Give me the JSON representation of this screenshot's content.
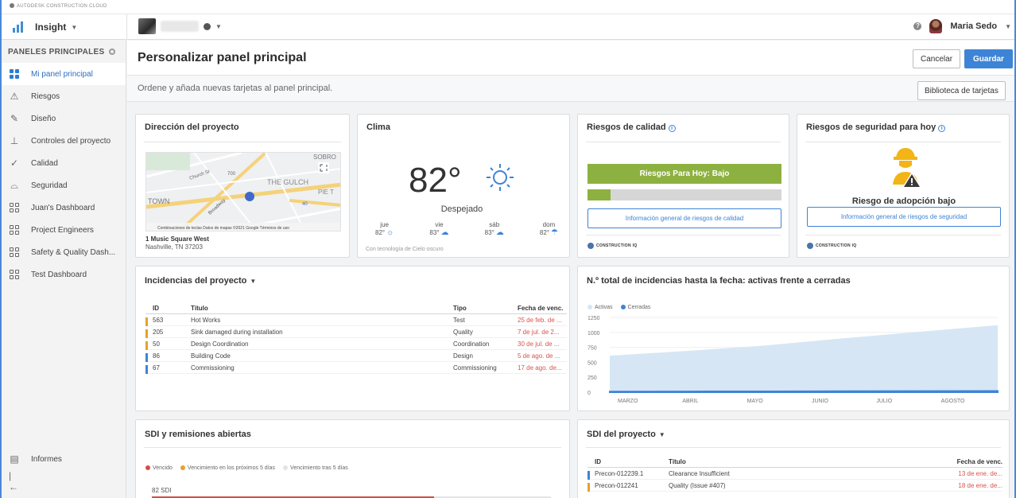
{
  "brand": "AUTODESK CONSTRUCTION CLOUD",
  "app": {
    "name": "Insight"
  },
  "user": {
    "name": "Maria Sedo"
  },
  "sidebar": {
    "section": "PANELES PRINCIPALES",
    "items": [
      {
        "label": "Mi panel principal",
        "icon": "dashboard-icon",
        "active": true
      },
      {
        "label": "Riesgos",
        "icon": "warning-icon"
      },
      {
        "label": "Diseño",
        "icon": "edit-icon"
      },
      {
        "label": "Controles del proyecto",
        "icon": "hierarchy-icon"
      },
      {
        "label": "Calidad",
        "icon": "check-icon"
      },
      {
        "label": "Seguridad",
        "icon": "helmet-icon"
      },
      {
        "label": "Juan's Dashboard",
        "icon": "dashboard-icon"
      },
      {
        "label": "Project Engineers",
        "icon": "dashboard-icon"
      },
      {
        "label": "Safety & Quality Dash...",
        "icon": "dashboard-icon"
      },
      {
        "label": "Test Dashboard",
        "icon": "dashboard-icon"
      }
    ],
    "reports": "Informes"
  },
  "page": {
    "title": "Personalizar panel principal",
    "cancel": "Cancelar",
    "save": "Guardar",
    "subtitle": "Ordene y añada nuevas tarjetas al panel principal.",
    "library": "Biblioteca de tarjetas"
  },
  "cards": {
    "location": {
      "title": "Dirección del proyecto",
      "map_labels": [
        "SOBRO",
        "THE GULCH",
        "PIE T",
        "TOWN",
        "Church St",
        "700",
        "Broadway",
        "40"
      ],
      "map_footer": "Combinaciones de teclas   Datos de mapas ©2021 Google   Términos de uso",
      "address1": "1 Music Square West",
      "address2": "Nashville, TN 37203"
    },
    "weather": {
      "title": "Clima",
      "temp": "82°",
      "condition": "Despejado",
      "forecast": [
        {
          "day": "jue",
          "temp": "82°",
          "icon": "sun-icon"
        },
        {
          "day": "vie",
          "temp": "83°",
          "icon": "partly-cloudy-icon"
        },
        {
          "day": "sáb",
          "temp": "83°",
          "icon": "partly-cloudy-icon"
        },
        {
          "day": "dom",
          "temp": "82°",
          "icon": "rain-icon"
        }
      ],
      "powered": "Con tecnología de Cielo oscuro"
    },
    "quality_risk": {
      "title": "Riesgos de calidad",
      "banner": "Riesgos Para Hoy: Bajo",
      "level": 0.12,
      "button": "Información general de riesgos de calidad",
      "brand": "CONSTRUCTION IQ"
    },
    "safety_risk": {
      "title": "Riesgos de seguridad para hoy",
      "status": "Riesgo de adopción bajo",
      "button": "Información general de riesgos de seguridad",
      "brand": "CONSTRUCTION IQ"
    },
    "issues": {
      "title": "Incidencias del proyecto",
      "columns": [
        "ID",
        "Título",
        "Tipo",
        "Fecha de venc."
      ],
      "rows": [
        {
          "id": "563",
          "title": "Hot Works",
          "type": "Test",
          "due": "25 de feb. de ...",
          "flag": "#e8a12a"
        },
        {
          "id": "205",
          "title": "Sink damaged during installation",
          "type": "Quality",
          "due": "7 de jul. de 2...",
          "flag": "#e8a12a"
        },
        {
          "id": "50",
          "title": "Design Coordination",
          "type": "Coordination",
          "due": "30 de jul. de ...",
          "flag": "#e8a12a"
        },
        {
          "id": "86",
          "title": "Building Code",
          "type": "Design",
          "due": "5 de ago. de ...",
          "flag": "#3d84d6"
        },
        {
          "id": "67",
          "title": "Commissioning",
          "type": "Commissioning",
          "due": "17 de ago. de...",
          "flag": "#3d84d6"
        }
      ]
    },
    "issues_chart": {
      "title": "N.º total de incidencias hasta la fecha: activas frente a cerradas"
    },
    "rfi": {
      "title": "SDI y remisiones abiertas",
      "legend": [
        {
          "label": "Vencido",
          "color": "#d84c42"
        },
        {
          "label": "Vencimiento en los próximos 5 días",
          "color": "#e8a12a"
        },
        {
          "label": "Vencimiento tras 5 días",
          "color": "#e4e4e4"
        }
      ],
      "total_label": "82 SDI",
      "overdue": 58,
      "later": 24
    },
    "project_rfi": {
      "title": "SDI del proyecto",
      "columns": [
        "ID",
        "Título",
        "Fecha de venc."
      ],
      "rows": [
        {
          "id": "Precon-012239.1",
          "title": "Clearance Insufficient",
          "due": "13 de ene. de...",
          "flag": "#3d84d6"
        },
        {
          "id": "Precon-012241",
          "title": "Quality (Issue #407)",
          "due": "18 de ene. de...",
          "flag": "#e8a12a"
        }
      ]
    }
  },
  "chart_data": {
    "type": "area",
    "title": "N.º total de incidencias hasta la fecha: activas frente a cerradas",
    "categories": [
      "MARZO",
      "ABRIL",
      "MAYO",
      "JUNIO",
      "JULIO",
      "AGOSTO"
    ],
    "y_ticks": [
      "1250",
      "1000",
      "750",
      "500",
      "250",
      "0"
    ],
    "ylim": [
      0,
      1250
    ],
    "series": [
      {
        "name": "Activas",
        "color": "#d6e6f5",
        "values": [
          610,
          690,
          780,
          900,
          1010,
          1120
        ]
      },
      {
        "name": "Cerradas",
        "color": "#3d84d6",
        "values": [
          10,
          12,
          14,
          16,
          18,
          20
        ]
      }
    ],
    "legend_position": "top-left"
  }
}
